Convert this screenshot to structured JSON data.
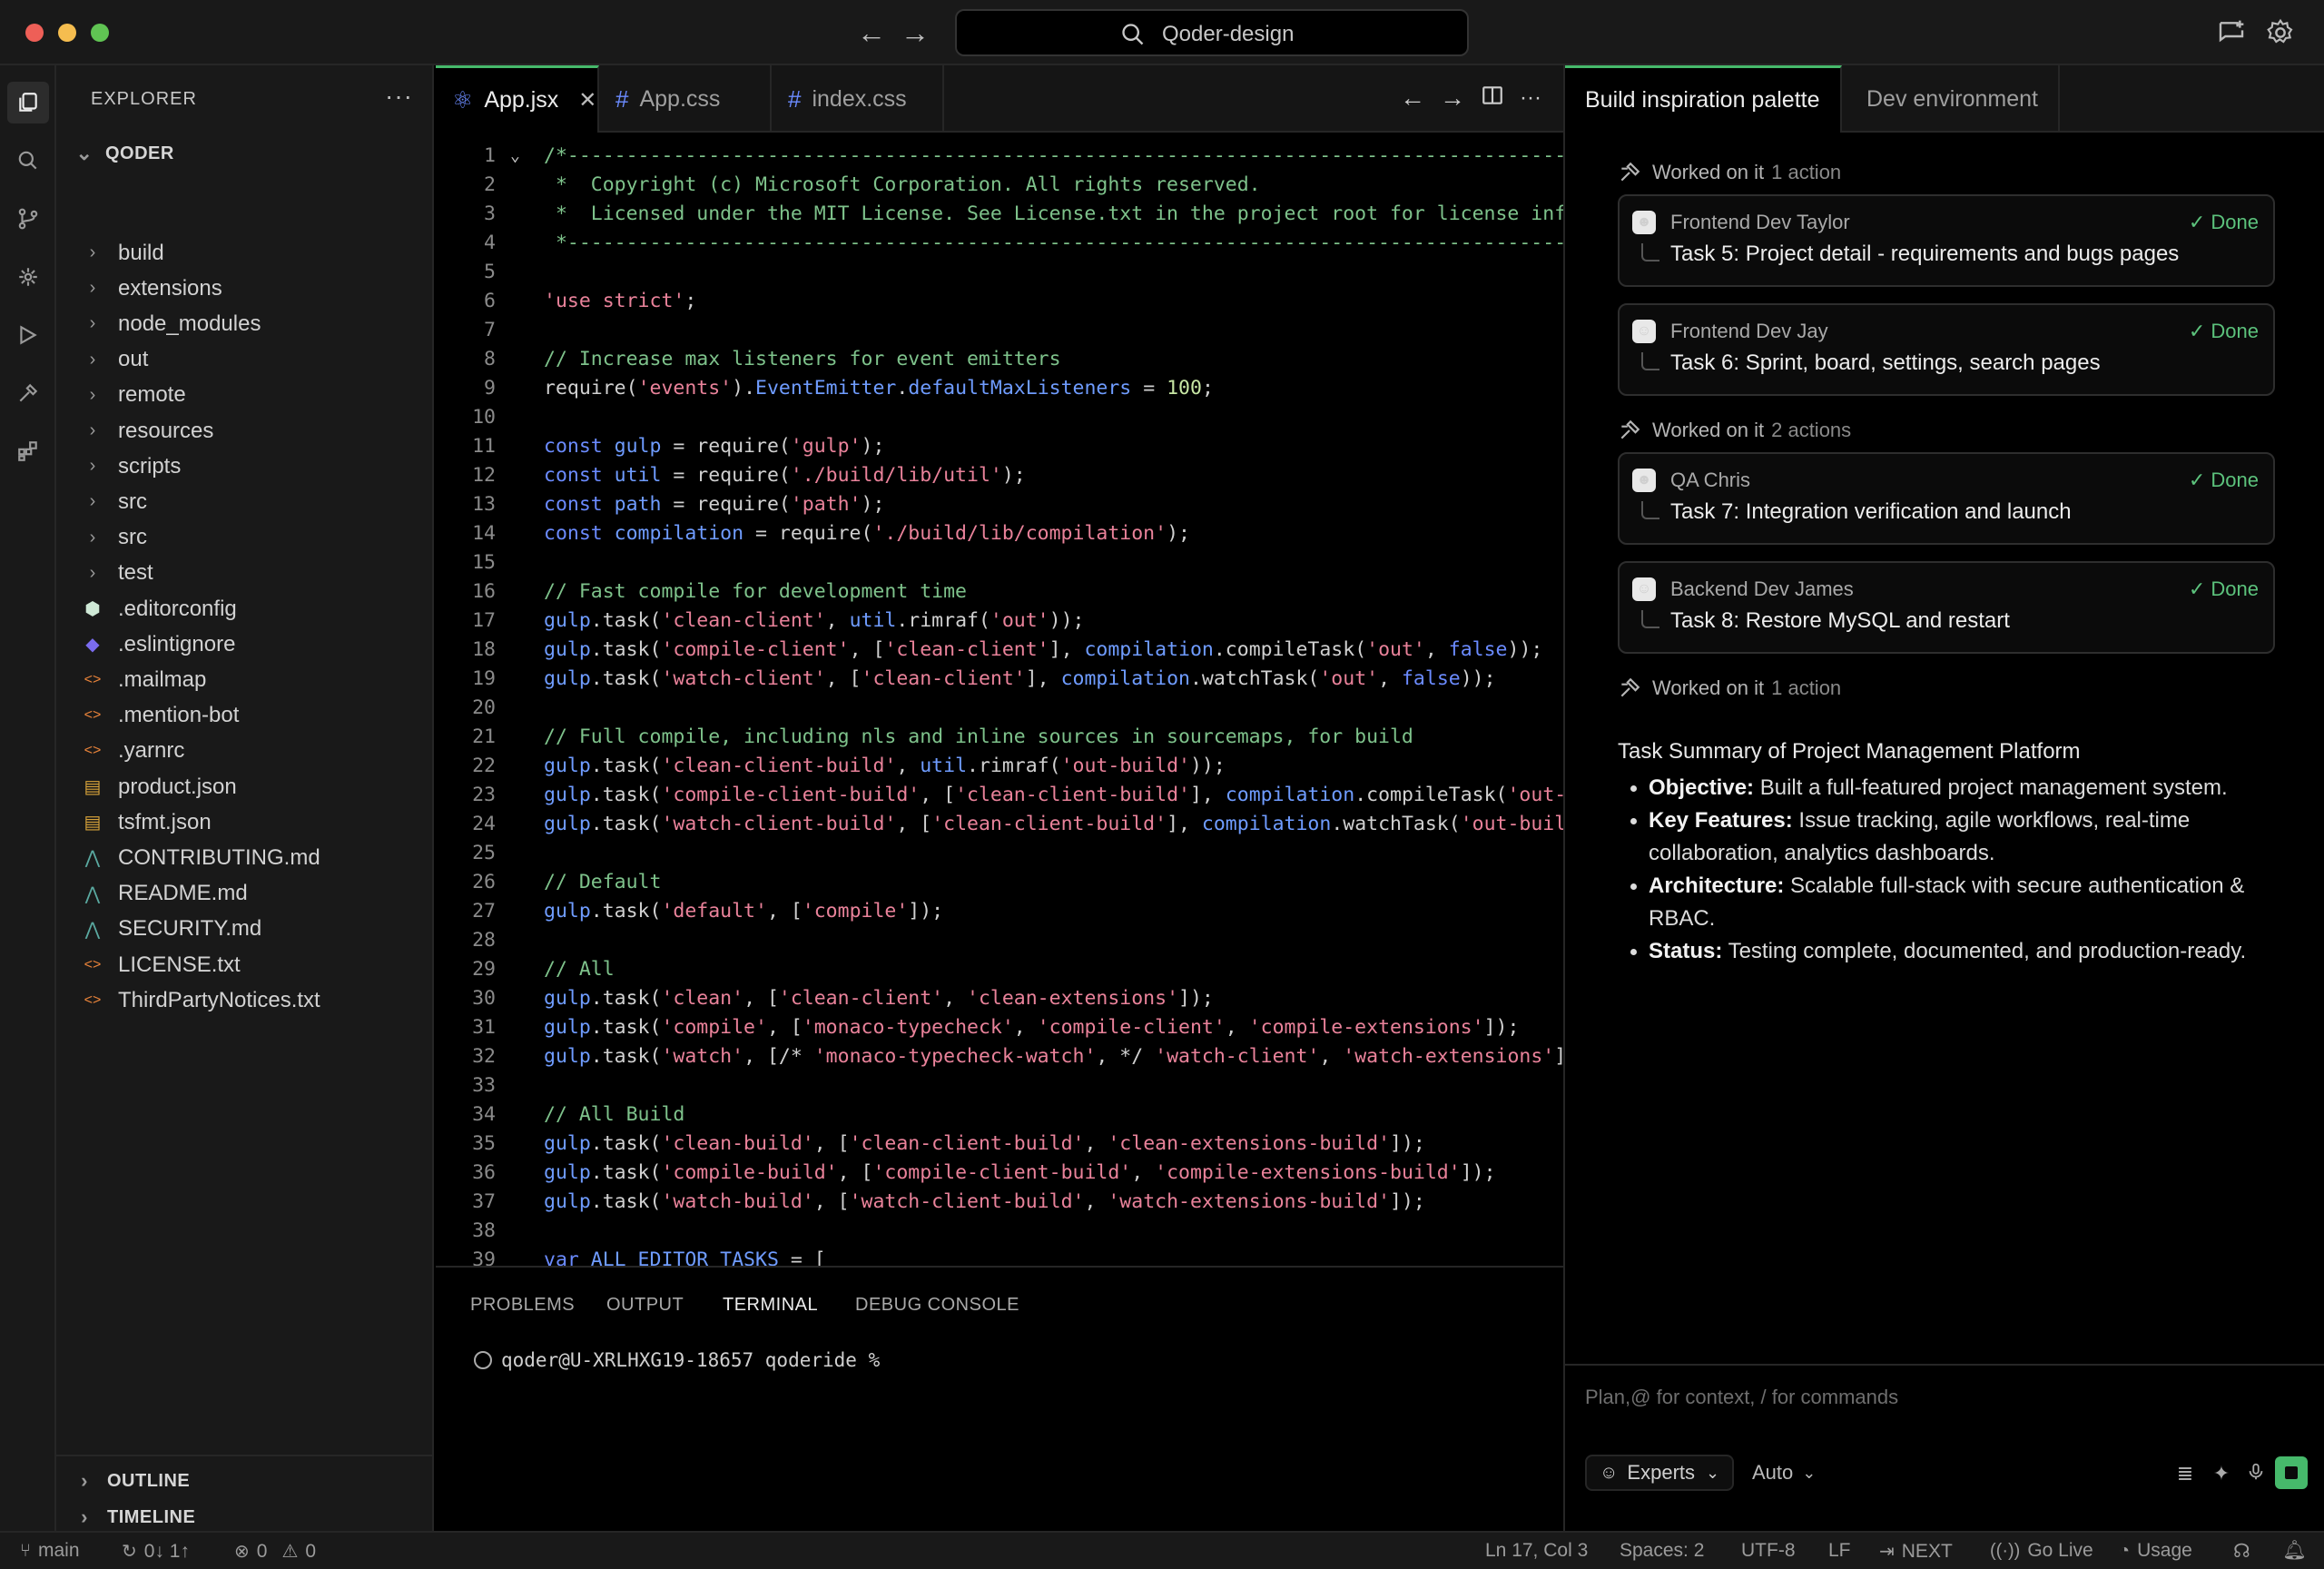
{
  "titlebar": {
    "search_text": "Qoder-design"
  },
  "sidebar": {
    "title": "EXPLORER",
    "more": "···",
    "root_label": "QODER",
    "items": [
      {
        "label": "build",
        "kind": "folder"
      },
      {
        "label": "extensions",
        "kind": "folder"
      },
      {
        "label": "node_modules",
        "kind": "folder"
      },
      {
        "label": "out",
        "kind": "folder"
      },
      {
        "label": "remote",
        "kind": "folder"
      },
      {
        "label": "resources",
        "kind": "folder"
      },
      {
        "label": "scripts",
        "kind": "folder"
      },
      {
        "label": "src",
        "kind": "folder"
      },
      {
        "label": "src",
        "kind": "folder"
      },
      {
        "label": "test",
        "kind": "folder"
      },
      {
        "label": ".editorconfig",
        "kind": "editorconfig"
      },
      {
        "label": ".eslintignore",
        "kind": "eslint"
      },
      {
        "label": ".mailmap",
        "kind": "code"
      },
      {
        "label": ".mention-bot",
        "kind": "code"
      },
      {
        "label": ".yarnrc",
        "kind": "code"
      },
      {
        "label": "product.json",
        "kind": "json"
      },
      {
        "label": "tsfmt.json",
        "kind": "json"
      },
      {
        "label": "CONTRIBUTING.md",
        "kind": "md"
      },
      {
        "label": "README.md",
        "kind": "md"
      },
      {
        "label": "SECURITY.md",
        "kind": "md"
      },
      {
        "label": "LICENSE.txt",
        "kind": "code"
      },
      {
        "label": "ThirdPartyNotices.txt",
        "kind": "code"
      }
    ],
    "outline_label": "OUTLINE",
    "timeline_label": "TIMELINE"
  },
  "editor": {
    "tabs": [
      {
        "label": "App.jsx",
        "icon": "react-icon",
        "active": true
      },
      {
        "label": "App.css",
        "icon": "hash-icon",
        "active": false
      },
      {
        "label": "index.css",
        "icon": "hash-icon",
        "active": false
      }
    ],
    "code_lines": [
      [
        [
          "cm",
          "/*------------------------------------------------------------------------------------------"
        ]
      ],
      [
        [
          "cm",
          " *  Copyright (c) Microsoft Corporation. All rights reserved."
        ]
      ],
      [
        [
          "cm",
          " *  Licensed under the MIT License. See License.txt in the project root for license information."
        ]
      ],
      [
        [
          "cm",
          " *------------------------------------------------------------------------------------------"
        ]
      ],
      [],
      [
        [
          "str",
          "'use strict'"
        ],
        [
          "p",
          ";"
        ]
      ],
      [],
      [
        [
          "cm",
          "// Increase max listeners for event emitters"
        ]
      ],
      [
        [
          "p",
          "require("
        ],
        [
          "str",
          "'events'"
        ],
        [
          "p",
          ")."
        ],
        [
          "id",
          "EventEmitter"
        ],
        [
          "p",
          "."
        ],
        [
          "id",
          "defaultMaxListeners"
        ],
        [
          "p",
          " = "
        ],
        [
          "num",
          "100"
        ],
        [
          "p",
          ";"
        ]
      ],
      [],
      [
        [
          "kw",
          "const "
        ],
        [
          "id",
          "gulp"
        ],
        [
          "p",
          " = require("
        ],
        [
          "str",
          "'gulp'"
        ],
        [
          "p",
          ");"
        ]
      ],
      [
        [
          "kw",
          "const "
        ],
        [
          "id",
          "util"
        ],
        [
          "p",
          " = require("
        ],
        [
          "str",
          "'./build/lib/util'"
        ],
        [
          "p",
          ");"
        ]
      ],
      [
        [
          "kw",
          "const "
        ],
        [
          "id",
          "path"
        ],
        [
          "p",
          " = require("
        ],
        [
          "str",
          "'path'"
        ],
        [
          "p",
          ");"
        ]
      ],
      [
        [
          "kw",
          "const "
        ],
        [
          "id",
          "compilation"
        ],
        [
          "p",
          " = require("
        ],
        [
          "str",
          "'./build/lib/compilation'"
        ],
        [
          "p",
          ");"
        ]
      ],
      [],
      [
        [
          "cm",
          "// Fast compile for development time"
        ]
      ],
      [
        [
          "id",
          "gulp"
        ],
        [
          "p",
          ".task("
        ],
        [
          "str",
          "'clean-client'"
        ],
        [
          "p",
          ", "
        ],
        [
          "id",
          "util"
        ],
        [
          "p",
          ".rimraf("
        ],
        [
          "str",
          "'out'"
        ],
        [
          "p",
          "));"
        ]
      ],
      [
        [
          "id",
          "gulp"
        ],
        [
          "p",
          ".task("
        ],
        [
          "str",
          "'compile-client'"
        ],
        [
          "p",
          ", ["
        ],
        [
          "str",
          "'clean-client'"
        ],
        [
          "p",
          "], "
        ],
        [
          "id",
          "compilation"
        ],
        [
          "p",
          ".compileTask("
        ],
        [
          "str",
          "'out'"
        ],
        [
          "p",
          ", "
        ],
        [
          "kw",
          "false"
        ],
        [
          "p",
          "));"
        ]
      ],
      [
        [
          "id",
          "gulp"
        ],
        [
          "p",
          ".task("
        ],
        [
          "str",
          "'watch-client'"
        ],
        [
          "p",
          ", ["
        ],
        [
          "str",
          "'clean-client'"
        ],
        [
          "p",
          "], "
        ],
        [
          "id",
          "compilation"
        ],
        [
          "p",
          ".watchTask("
        ],
        [
          "str",
          "'out'"
        ],
        [
          "p",
          ", "
        ],
        [
          "kw",
          "false"
        ],
        [
          "p",
          "));"
        ]
      ],
      [],
      [
        [
          "cm",
          "// Full compile, including nls and inline sources in sourcemaps, for build"
        ]
      ],
      [
        [
          "id",
          "gulp"
        ],
        [
          "p",
          ".task("
        ],
        [
          "str",
          "'clean-client-build'"
        ],
        [
          "p",
          ", "
        ],
        [
          "id",
          "util"
        ],
        [
          "p",
          ".rimraf("
        ],
        [
          "str",
          "'out-build'"
        ],
        [
          "p",
          "));"
        ]
      ],
      [
        [
          "id",
          "gulp"
        ],
        [
          "p",
          ".task("
        ],
        [
          "str",
          "'compile-client-build'"
        ],
        [
          "p",
          ", ["
        ],
        [
          "str",
          "'clean-client-build'"
        ],
        [
          "p",
          "], "
        ],
        [
          "id",
          "compilation"
        ],
        [
          "p",
          ".compileTask("
        ],
        [
          "str",
          "'out-build'"
        ],
        [
          "p",
          ", "
        ],
        [
          "kw",
          "true"
        ],
        [
          "p",
          "));"
        ]
      ],
      [
        [
          "id",
          "gulp"
        ],
        [
          "p",
          ".task("
        ],
        [
          "str",
          "'watch-client-build'"
        ],
        [
          "p",
          ", ["
        ],
        [
          "str",
          "'clean-client-build'"
        ],
        [
          "p",
          "], "
        ],
        [
          "id",
          "compilation"
        ],
        [
          "p",
          ".watchTask("
        ],
        [
          "str",
          "'out-build'"
        ],
        [
          "p",
          ", "
        ],
        [
          "kw",
          "true"
        ],
        [
          "p",
          "));"
        ]
      ],
      [],
      [
        [
          "cm",
          "// Default"
        ]
      ],
      [
        [
          "id",
          "gulp"
        ],
        [
          "p",
          ".task("
        ],
        [
          "str",
          "'default'"
        ],
        [
          "p",
          ", ["
        ],
        [
          "str",
          "'compile'"
        ],
        [
          "p",
          "]);"
        ]
      ],
      [],
      [
        [
          "cm",
          "// All"
        ]
      ],
      [
        [
          "id",
          "gulp"
        ],
        [
          "p",
          ".task("
        ],
        [
          "str",
          "'clean'"
        ],
        [
          "p",
          ", ["
        ],
        [
          "str",
          "'clean-client'"
        ],
        [
          "p",
          ", "
        ],
        [
          "str",
          "'clean-extensions'"
        ],
        [
          "p",
          "]);"
        ]
      ],
      [
        [
          "id",
          "gulp"
        ],
        [
          "p",
          ".task("
        ],
        [
          "str",
          "'compile'"
        ],
        [
          "p",
          ", ["
        ],
        [
          "str",
          "'monaco-typecheck'"
        ],
        [
          "p",
          ", "
        ],
        [
          "str",
          "'compile-client'"
        ],
        [
          "p",
          ", "
        ],
        [
          "str",
          "'compile-extensions'"
        ],
        [
          "p",
          "]);"
        ]
      ],
      [
        [
          "id",
          "gulp"
        ],
        [
          "p",
          ".task("
        ],
        [
          "str",
          "'watch'"
        ],
        [
          "p",
          ", [/* "
        ],
        [
          "str",
          "'monaco-typecheck-watch'"
        ],
        [
          "p",
          ", */ "
        ],
        [
          "str",
          "'watch-client'"
        ],
        [
          "p",
          ", "
        ],
        [
          "str",
          "'watch-extensions'"
        ],
        [
          "p",
          "]);"
        ]
      ],
      [],
      [
        [
          "cm",
          "// All Build"
        ]
      ],
      [
        [
          "id",
          "gulp"
        ],
        [
          "p",
          ".task("
        ],
        [
          "str",
          "'clean-build'"
        ],
        [
          "p",
          ", ["
        ],
        [
          "str",
          "'clean-client-build'"
        ],
        [
          "p",
          ", "
        ],
        [
          "str",
          "'clean-extensions-build'"
        ],
        [
          "p",
          "]);"
        ]
      ],
      [
        [
          "id",
          "gulp"
        ],
        [
          "p",
          ".task("
        ],
        [
          "str",
          "'compile-build'"
        ],
        [
          "p",
          ", ["
        ],
        [
          "str",
          "'compile-client-build'"
        ],
        [
          "p",
          ", "
        ],
        [
          "str",
          "'compile-extensions-build'"
        ],
        [
          "p",
          "]);"
        ]
      ],
      [
        [
          "id",
          "gulp"
        ],
        [
          "p",
          ".task("
        ],
        [
          "str",
          "'watch-build'"
        ],
        [
          "p",
          ", ["
        ],
        [
          "str",
          "'watch-client-build'"
        ],
        [
          "p",
          ", "
        ],
        [
          "str",
          "'watch-extensions-build'"
        ],
        [
          "p",
          "]);"
        ]
      ],
      [],
      [
        [
          "kw",
          "var "
        ],
        [
          "id",
          "ALL_EDITOR_TASKS"
        ],
        [
          "p",
          " = ["
        ]
      ]
    ]
  },
  "panel": {
    "tabs": [
      "PROBLEMS",
      "OUTPUT",
      "TERMINAL",
      "DEBUG CONSOLE"
    ],
    "active_tab": "TERMINAL",
    "terminal_prompt": "qoder@U-XRLHXG19-18657 qoderide %"
  },
  "chat": {
    "tabs": [
      "Build inspiration palette",
      "Dev environment"
    ],
    "groups": [
      {
        "worked_label": "Worked on it",
        "worked_count": "1 action",
        "tasks": [
          {
            "agent": "Frontend Dev Taylor",
            "status": "Done",
            "task": "Task 5: Project detail - requirements and bugs pages"
          },
          {
            "agent": "Frontend Dev Jay",
            "status": "Done",
            "task": "Task 6: Sprint, board, settings, search pages"
          }
        ]
      },
      {
        "worked_label": "Worked on it",
        "worked_count": "2 actions",
        "tasks": [
          {
            "agent": "QA Chris",
            "status": "Done",
            "task": "Task 7: Integration verification and launch"
          },
          {
            "agent": "Backend Dev James",
            "status": "Done",
            "task": "Task 8: Restore MySQL and restart"
          }
        ]
      },
      {
        "worked_label": "Worked on it",
        "worked_count": "1 action",
        "tasks": []
      }
    ],
    "summary_title": "Task Summary of Project Management Platform",
    "summary_items": [
      {
        "label": "Objective:",
        "text": " Built a full-featured project management system."
      },
      {
        "label": "Key Features:",
        "text": " Issue tracking, agile workflows, real-time collaboration, analytics dashboards."
      },
      {
        "label": "Architecture:",
        "text": " Scalable full-stack with secure authentication & RBAC."
      },
      {
        "label": "Status:",
        "text": " Testing complete, documented, and production-ready."
      }
    ],
    "input_placeholder": "Plan,@ for context, / for commands",
    "mode_label": "Experts",
    "model_label": "Auto"
  },
  "statusbar": {
    "branch": "main",
    "sync": "0↓ 1↑",
    "errors": "0",
    "warnings": "0",
    "position": "Ln 17, Col 3",
    "spaces": "Spaces: 2",
    "encoding": "UTF-8",
    "eol": "LF",
    "next": "NEXT",
    "golive": "Go Live",
    "usage": "Usage"
  },
  "colors": {
    "accent_green": "#46b96b",
    "done_green": "#5cc27c",
    "comment": "#7ec28b",
    "string": "#e9829a",
    "keyword": "#6b8bff"
  }
}
